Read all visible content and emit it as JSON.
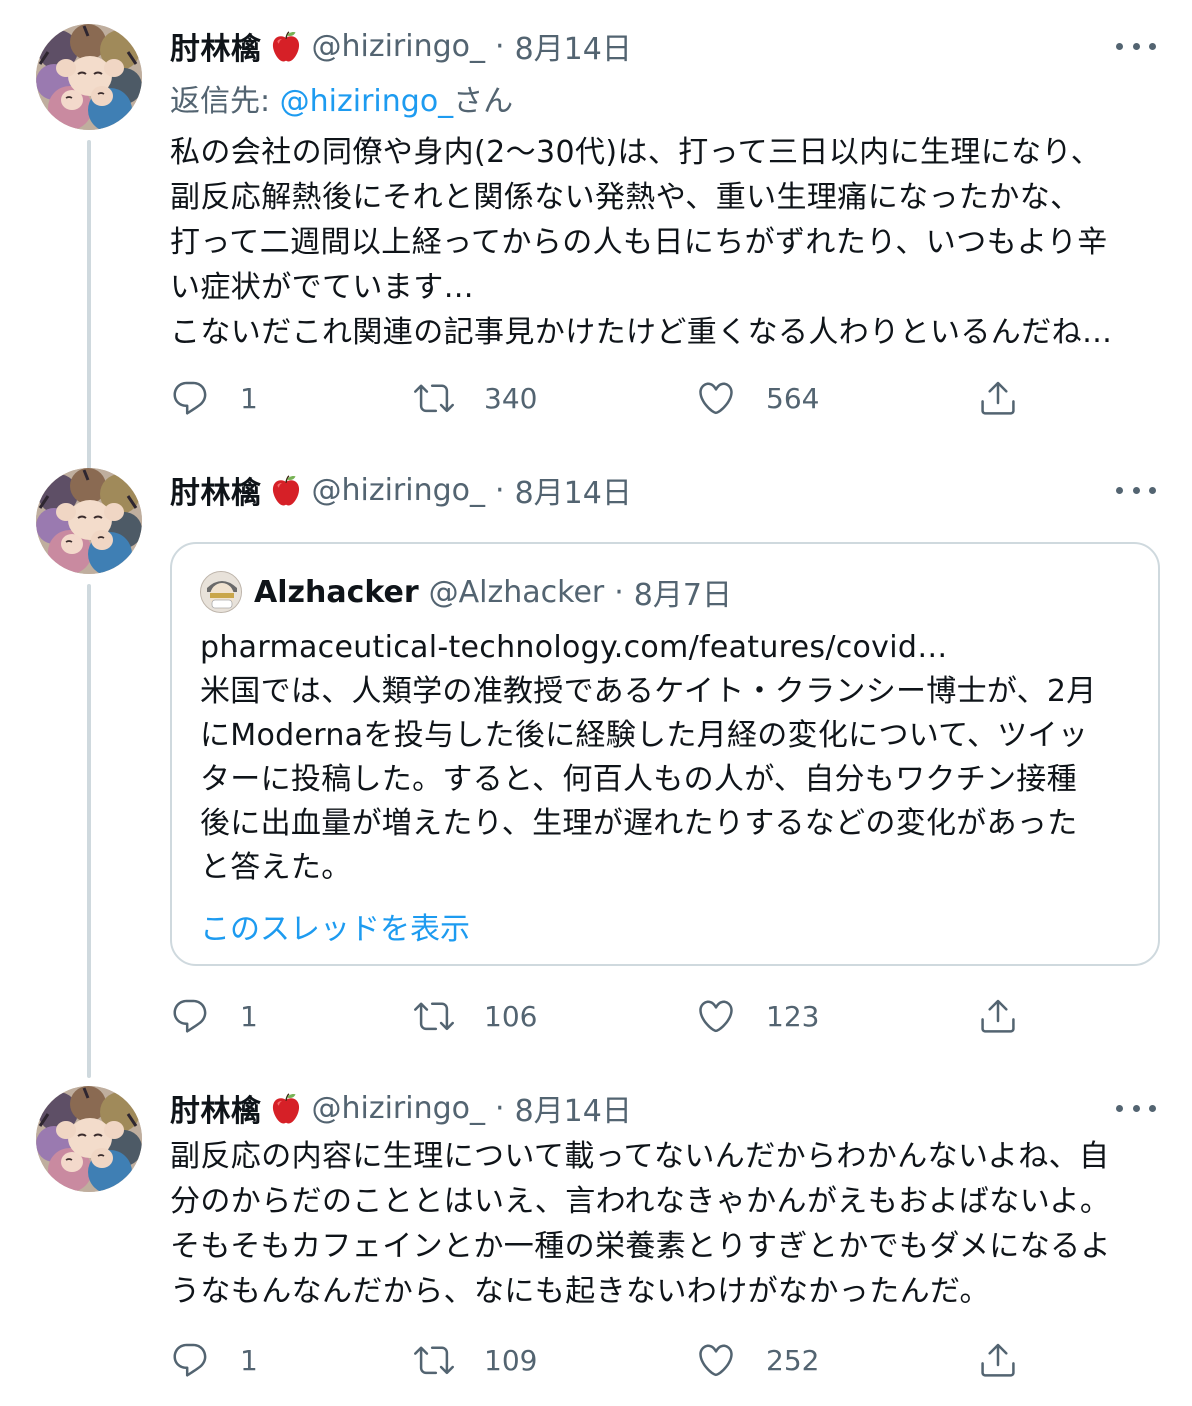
{
  "colors": {
    "text": "#0f1419",
    "secondary": "#536471",
    "link": "#1d9bf0",
    "border": "#cfd9de",
    "apple": "#d62027"
  },
  "tweets": [
    {
      "author_name": "肘林檎",
      "author_emoji": "apple-icon",
      "handle": "@hiziringo_",
      "dot": "·",
      "date": "8月14日",
      "reply_prefix": "返信先: ",
      "reply_mention": "@hiziringo_",
      "reply_suffix": "さん",
      "lines": [
        "私の会社の同僚や身内(2〜30代)は、打って三日以内に生理になり、",
        "副反応解熱後にそれと関係ない発熱や、重い生理痛になったかな、",
        "打って二週間以上経ってからの人も日にちがずれたり、いつもより辛",
        "い症状がでています…",
        "こないだこれ関連の記事見かけたけど重くなる人わりといるんだね…"
      ],
      "reply_count": "1",
      "retweet_count": "340",
      "like_count": "564"
    },
    {
      "author_name": "肘林檎",
      "author_emoji": "apple-icon",
      "handle": "@hiziringo_",
      "dot": "·",
      "date": "8月14日",
      "quote": {
        "name": "Alzhacker",
        "handle": "@Alzhacker",
        "dot": "·",
        "date": "8月7日",
        "lines": [
          "pharmaceutical-technology.com/features/covid…",
          "米国では、人類学の准教授であるケイト・クランシー博士が、2月",
          "にModernaを投与した後に経験した月経の変化について、ツイッ",
          "ターに投稿した。すると、何百人もの人が、自分もワクチン接種",
          "後に出血量が増えたり、生理が遅れたりするなどの変化があった",
          "と答えた。"
        ],
        "show_thread": "このスレッドを表示"
      },
      "reply_count": "1",
      "retweet_count": "106",
      "like_count": "123"
    },
    {
      "author_name": "肘林檎",
      "author_emoji": "apple-icon",
      "handle": "@hiziringo_",
      "dot": "·",
      "date": "8月14日",
      "lines": [
        "副反応の内容に生理について載ってないんだからわかんないよね、自",
        "分のからだのこととはいえ、言われなきゃかんがえもおよばないよ。",
        "そもそもカフェインとか一種の栄養素とりすぎとかでもダメになるよ",
        "うなもんなんだから、なにも起きないわけがなかったんだ。"
      ],
      "reply_count": "1",
      "retweet_count": "109",
      "like_count": "252"
    }
  ]
}
